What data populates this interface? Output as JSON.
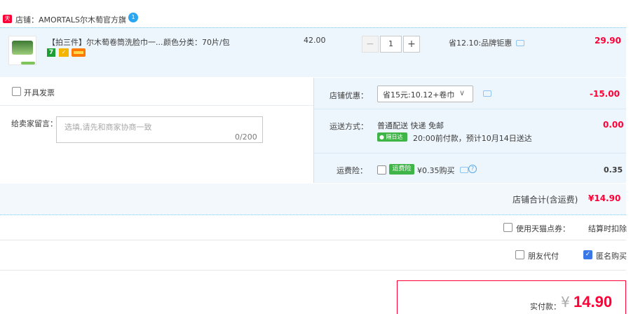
{
  "shop": {
    "badge": "天猫",
    "name": "店铺：AMORTALS尔木萄官方旗",
    "chat_badge": "1"
  },
  "item": {
    "title": "【拍三件】尔木萄卷筒洗脸巾一...",
    "sku": "颜色分类：70片/包",
    "tag1": "7",
    "unit_price": "42.00",
    "quantity": "1",
    "minus": "−",
    "plus": "+",
    "discount_note": "省12.10:品牌钜惠",
    "total": "29.90"
  },
  "options": {
    "invoice_label": "开具发票",
    "message_label": "给卖家留言：",
    "message_placeholder": "选填,请先和商家协商一致",
    "message_counter": "0/200",
    "store_discount_label": "店铺优惠：",
    "store_discount_value": "省15元:10.12+卷巾",
    "store_discount_amount": "-15.00",
    "shipping_label": "运送方式：",
    "shipping_method": "普通配送 快递 免邮",
    "shipping_badge": "隔日达",
    "shipping_eta": "20:00前付款，预计10月14日送达",
    "shipping_amount": "0.00",
    "insurance_label": "运费险：",
    "insurance_badge": "运费险",
    "insurance_price": "¥0.35购买",
    "insurance_amount": "0.35"
  },
  "shop_total": {
    "label": "店铺合计(含运费)",
    "amount": "¥14.90"
  },
  "extras": {
    "tmall_points_label": "使用天猫点券：",
    "tmall_points_note": "结算时扣除",
    "friend_pay_label": "朋友代付",
    "anonymous_label": "匿名购买"
  },
  "payment": {
    "label": "实付款：",
    "currency": "¥",
    "amount": "14.90"
  },
  "colors": {
    "accent": "#ff0036",
    "highlight_bg": "#eef6fd",
    "badge_green": "#3fb447",
    "checkbox_blue": "#3b78e7"
  }
}
